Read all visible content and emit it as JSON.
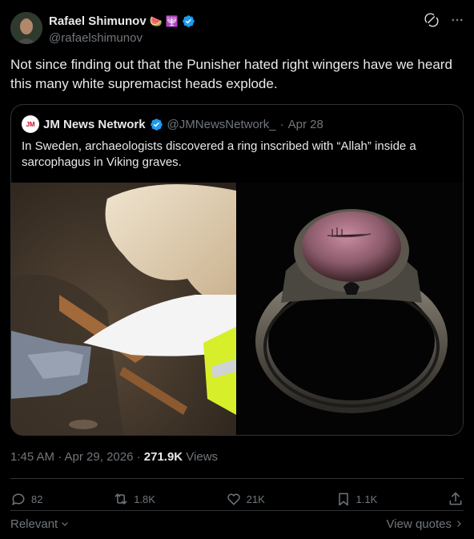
{
  "author": {
    "name": "Rafael Shimunov",
    "emojis": [
      "🍉",
      "🕎"
    ],
    "handle": "@rafaelshimunov"
  },
  "tweet_text": "Not since finding out that the Punisher hated right wingers have we heard this many white supremacist heads explode.",
  "quote": {
    "avatar_text": "JM",
    "name": "JM News Network",
    "handle": "@JMNewsNetwork_",
    "separator": "·",
    "date": "Apr 28",
    "text": "In Sweden, archaeologists discovered a ring inscribed with “Allah” inside a sarcophagus in Viking graves."
  },
  "meta": {
    "time": "1:45 AM · Apr 29, 2026 · ",
    "views_count": "271.9K",
    "views_label": " Views"
  },
  "actions": {
    "replies": "82",
    "reposts": "1.8K",
    "likes": "21K",
    "bookmarks": "1.1K"
  },
  "footer": {
    "sort_label": "Relevant",
    "view_quotes": "View quotes"
  },
  "colors": {
    "background": "#000000",
    "text": "#e7e9ea",
    "muted": "#71767b",
    "border": "#2f3336",
    "verified": "#1d9bf0"
  }
}
